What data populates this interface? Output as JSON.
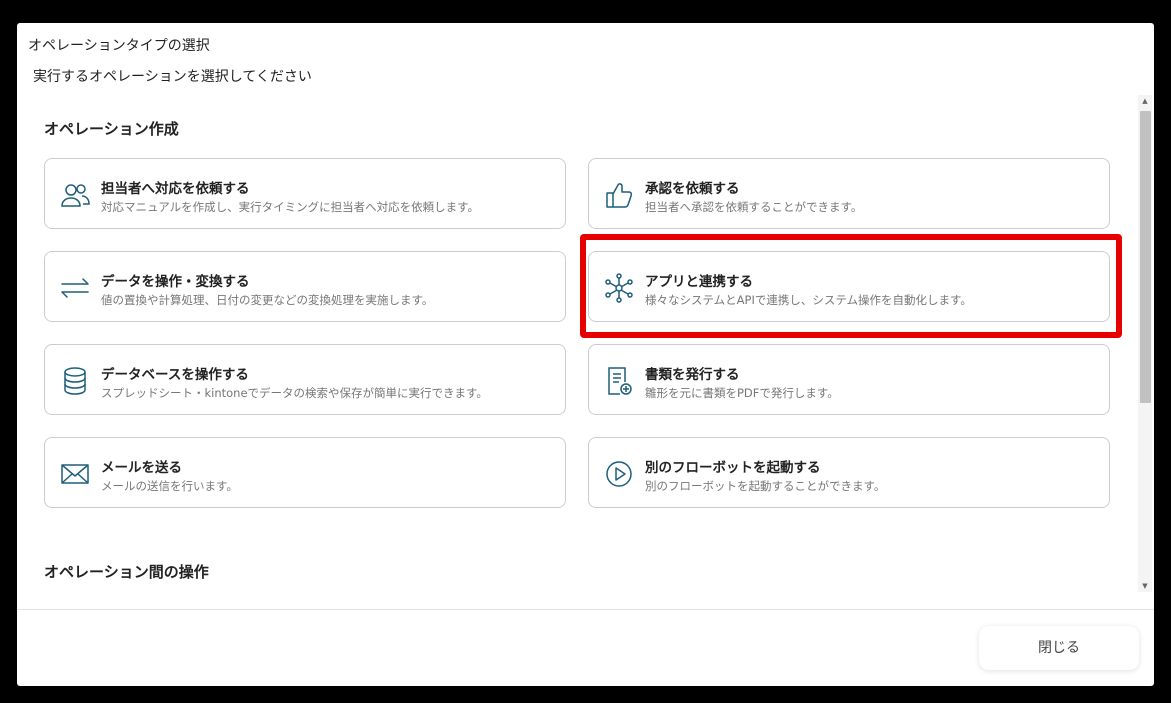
{
  "dialog": {
    "title": "オペレーションタイプの選択",
    "subtitle": "実行するオペレーションを選択してください"
  },
  "sections": [
    {
      "heading": "オペレーション作成",
      "cards": [
        {
          "icon": "people-icon",
          "title": "担当者へ対応を依頼する",
          "description": "対応マニュアルを作成し、実行タイミングに担当者へ対応を依頼します。"
        },
        {
          "icon": "thumbs-up-icon",
          "title": "承認を依頼する",
          "description": "担当者へ承認を依頼することができます。"
        },
        {
          "icon": "arrows-exchange-icon",
          "title": "データを操作・変換する",
          "description": "値の置換や計算処理、日付の変更などの変換処理を実施します。"
        },
        {
          "icon": "network-hub-icon",
          "title": "アプリと連携する",
          "description": "様々なシステムとAPIで連携し、システム操作を自動化します。"
        },
        {
          "icon": "database-icon",
          "title": "データベースを操作する",
          "description": "スプレッドシート・kintoneでデータの検索や保存が簡単に実行できます。"
        },
        {
          "icon": "document-add-icon",
          "title": "書類を発行する",
          "description": "雛形を元に書類をPDFで発行します。"
        },
        {
          "icon": "envelope-icon",
          "title": "メールを送る",
          "description": "メールの送信を行います。"
        },
        {
          "icon": "play-circle-icon",
          "title": "別のフローボットを起動する",
          "description": "別のフローボットを起動することができます。"
        }
      ]
    },
    {
      "heading": "オペレーション間の操作"
    }
  ],
  "footer": {
    "close_label": "閉じる"
  },
  "colors": {
    "icon": "#1f5f7a",
    "highlight": "#e60000",
    "card_border": "#c9cdd2"
  }
}
